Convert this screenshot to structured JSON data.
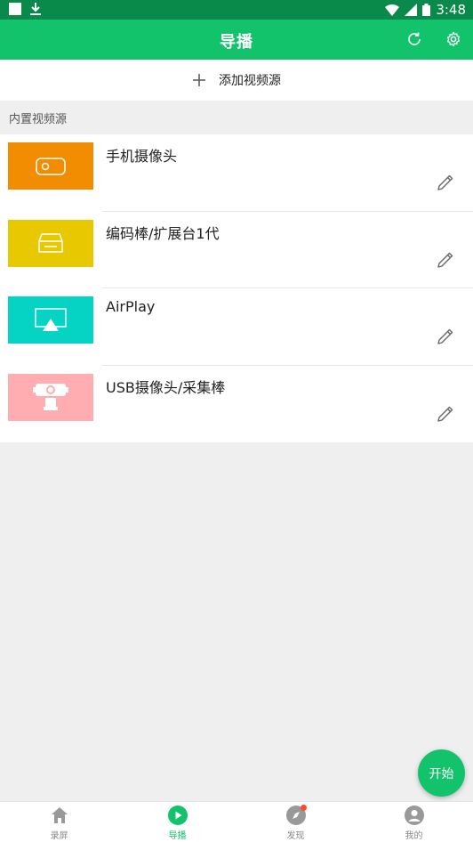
{
  "status_bar": {
    "time": "3:48"
  },
  "app_bar": {
    "title": "导播"
  },
  "add_source": {
    "label": "添加视频源"
  },
  "section": {
    "title": "内置视频源"
  },
  "sources": [
    {
      "title": "手机摄像头",
      "color": "#f28c00",
      "icon": "phone-camera-icon"
    },
    {
      "title": "编码棒/扩展台1代",
      "color": "#e8c800",
      "icon": "encoder-device-icon"
    },
    {
      "title": "AirPlay",
      "color": "#05d4c4",
      "icon": "airplay-icon"
    },
    {
      "title": "USB摄像头/采集棒",
      "color": "#ffadb0",
      "icon": "webcam-icon"
    }
  ],
  "fab": {
    "label": "开始"
  },
  "bottom_nav": [
    {
      "label": "录屏",
      "icon": "home-icon"
    },
    {
      "label": "导播",
      "icon": "play-icon",
      "active": true
    },
    {
      "label": "发现",
      "icon": "compass-icon"
    },
    {
      "label": "我的",
      "icon": "profile-icon"
    }
  ],
  "colors": {
    "primary": "#13c36c",
    "status_bar": "#0a8a4a",
    "badge": "#ff4a2a"
  }
}
